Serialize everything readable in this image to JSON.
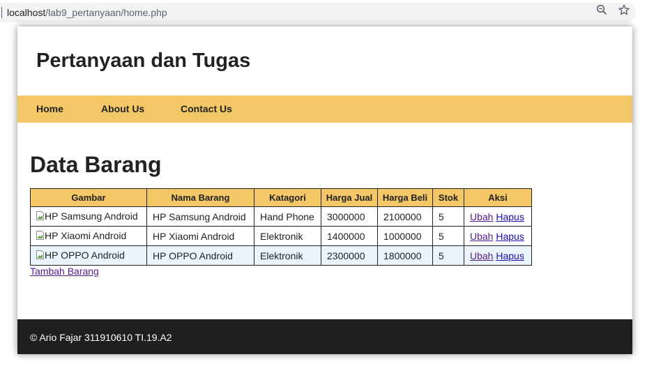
{
  "browser": {
    "url_host": "localhost",
    "url_path": "/lab9_pertanyaan/home.php",
    "icons": [
      "zoom-icon",
      "star-icon"
    ]
  },
  "site": {
    "title": "Pertanyaan dan Tugas"
  },
  "nav": {
    "items": [
      {
        "label": "Home"
      },
      {
        "label": "About Us"
      },
      {
        "label": "Contact Us"
      }
    ]
  },
  "main": {
    "heading": "Data Barang",
    "table": {
      "headers": [
        "Gambar",
        "Nama Barang",
        "Katagori",
        "Harga Jual",
        "Harga Beli",
        "Stok",
        "Aksi"
      ],
      "rows": [
        {
          "gambar_alt": "HP Samsung Android",
          "nama": "HP Samsung Android",
          "kategori": "Hand Phone",
          "harga_jual": "3000000",
          "harga_beli": "2100000",
          "stok": "5",
          "ubah": "Ubah",
          "hapus": "Hapus"
        },
        {
          "gambar_alt": "HP Xiaomi Android",
          "nama": "HP Xiaomi Android",
          "kategori": "Elektronik",
          "harga_jual": "1400000",
          "harga_beli": "1000000",
          "stok": "5",
          "ubah": "Ubah",
          "hapus": "Hapus"
        },
        {
          "gambar_alt": "HP OPPO Android",
          "nama": "HP OPPO Android",
          "kategori": "Elektronik",
          "harga_jual": "2300000",
          "harga_beli": "1800000",
          "stok": "5",
          "ubah": "Ubah",
          "hapus": "Hapus"
        }
      ]
    },
    "add_link": "Tambah Barang"
  },
  "footer": {
    "text": "© Ario Fajar 311910610 TI.19.A2"
  },
  "colors": {
    "accent": "#f3c766",
    "footer_bg": "#1f1f1f",
    "row_alt": "#eaf4fb",
    "link": "#1a0dab",
    "visited_link": "#551a8b"
  }
}
